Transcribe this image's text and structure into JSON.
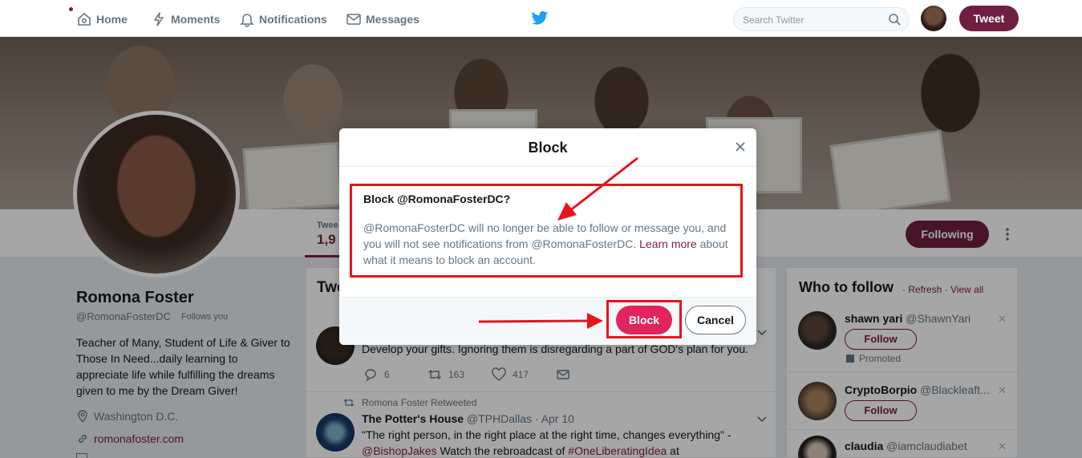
{
  "nav": {
    "home": "Home",
    "moments": "Moments",
    "notifications": "Notifications",
    "messages": "Messages",
    "search_placeholder": "Search Twitter",
    "tweet_button": "Tweet"
  },
  "profile": {
    "name": "Romona Foster",
    "handle": "@RomonaFosterDC",
    "follows_you": "Follows you",
    "bio": "Teacher of Many, Student of Life & Giver to Those In Need...daily learning to appreciate life while fulfilling the dreams given to me by the Dream Giver!",
    "location": "Washington D.C.",
    "website": "romonafoster.com",
    "stat_label": "Twee",
    "stat_value": "1,9",
    "following_button": "Following"
  },
  "timeline": {
    "title": "Twe",
    "tweets": [
      {
        "text": "Develop your gifts. Ignoring them is disregarding a part of GOD's plan for you.",
        "replies": "6",
        "retweets": "163",
        "likes": "417"
      },
      {
        "retweet_note": "Romona Foster Retweeted",
        "author": "The Potter's House",
        "author_handle": "@TPHDallas",
        "date": "· Apr 10",
        "line1": "\"The right person, in the right place at the right time, changes everything\" -",
        "line2_mention": "@BishopJakes",
        "line2_text": " Watch the rebroadcast of ",
        "line2_hashtag": "#OneLiberatingIdea",
        "line2_end": " at"
      }
    ]
  },
  "who_to_follow": {
    "title": "Who to follow",
    "refresh": "· Refresh",
    "view_all": "· View all",
    "follow_label": "Follow",
    "promoted": "Promoted",
    "users": [
      {
        "name": "shawn yari",
        "handle": "@ShawnYari"
      },
      {
        "name": "CryptoBorpio",
        "handle": "@Blackleaft..."
      },
      {
        "name": "claudia",
        "handle": "@iamclaudiabet"
      }
    ]
  },
  "modal": {
    "title": "Block",
    "question": "Block @RomonaFosterDC?",
    "body_part1": "@RomonaFosterDC will no longer be able to follow or message you, and you will not see notifications from @RomonaFosterDC. ",
    "learn_more": "Learn more",
    "body_part2": " about what it means to block an account.",
    "block_button": "Block",
    "cancel_button": "Cancel"
  },
  "colors": {
    "brand": "#6e1f3f",
    "block_red": "#e0245e",
    "annotation_red": "#e8141a",
    "twitter_blue": "#1da1f2"
  }
}
